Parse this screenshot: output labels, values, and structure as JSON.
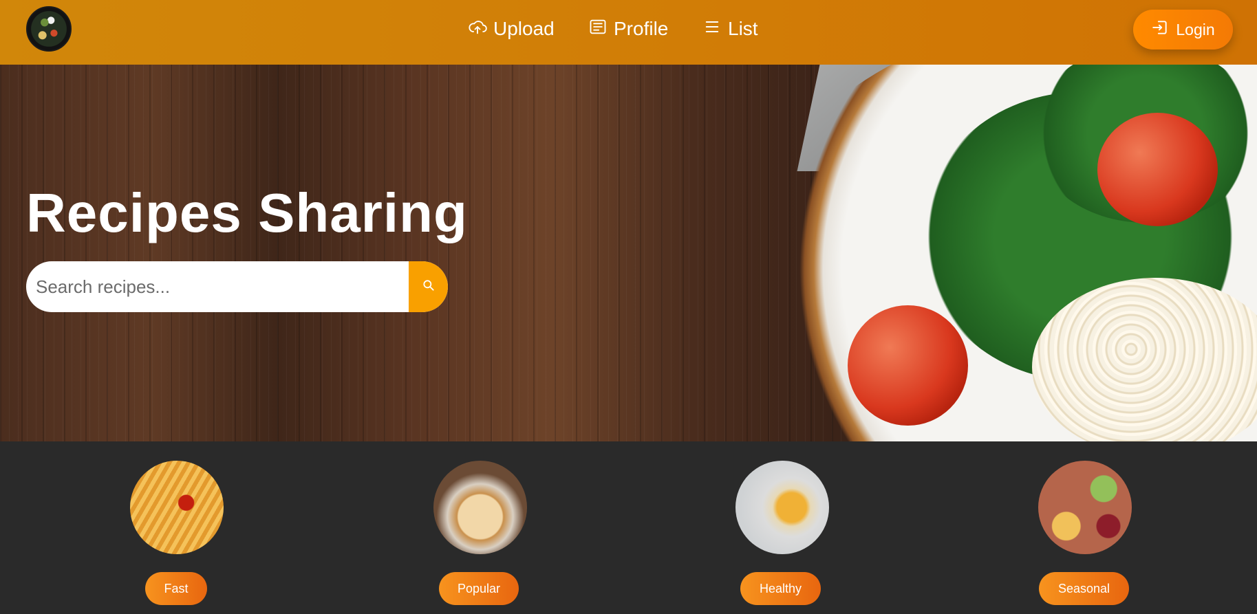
{
  "header": {
    "logo_icon": "site-logo",
    "nav": [
      {
        "label": "Upload",
        "icon": "cloud-upload-icon"
      },
      {
        "label": "Profile",
        "icon": "id-card-icon"
      },
      {
        "label": "List",
        "icon": "list-icon"
      }
    ],
    "login_label": "Login",
    "login_icon": "login-icon"
  },
  "hero": {
    "title": "Recipes Sharing",
    "search_placeholder": "Search recipes...",
    "search_icon": "search-icon"
  },
  "categories": [
    {
      "label": "Fast"
    },
    {
      "label": "Popular"
    },
    {
      "label": "Healthy"
    },
    {
      "label": "Seasonal"
    }
  ],
  "colors": {
    "header": "#d1870a",
    "accent": "#ff8a00",
    "search_button": "#f9a000",
    "page_background": "#2a2a2a"
  }
}
